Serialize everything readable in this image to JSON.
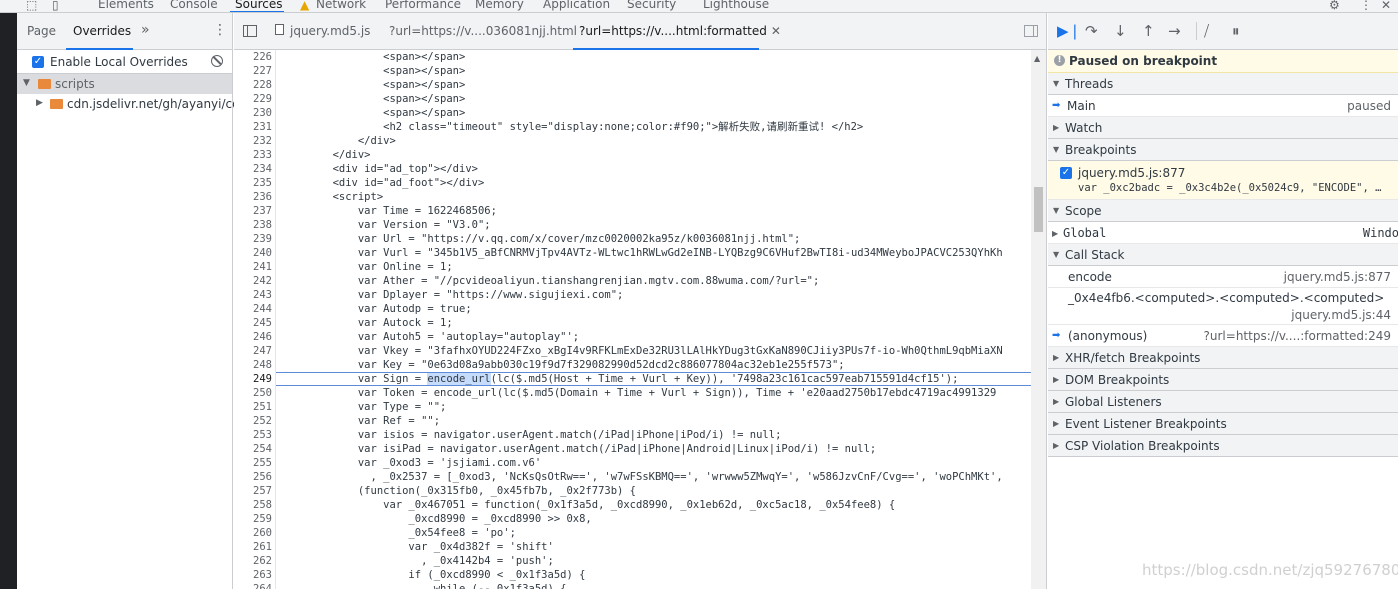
{
  "topbar": {
    "tabs": [
      "Elements",
      "Console",
      "Sources",
      "Network",
      "Performance",
      "Memory",
      "Application",
      "Security",
      "Lighthouse"
    ],
    "active_tab": "Sources",
    "close_glyph": "✕"
  },
  "navigator": {
    "tabs": [
      "Page",
      "Overrides"
    ],
    "active": "Overrides",
    "more": "»",
    "kebab": "⋮",
    "enable_local_overrides": "Enable Local Overrides",
    "tree": [
      {
        "label": "scripts"
      },
      {
        "label": "cdn.jsdelivr.net/gh/ayanyi/cdn@"
      }
    ]
  },
  "editor": {
    "tabs": [
      "jquery.md5.js",
      "?url=https://v....036081njj.html",
      "?url=https://v....html:formatted"
    ],
    "close_glyph": "✕",
    "lines": [
      {
        "n": "226",
        "t": "                <span></span>"
      },
      {
        "n": "227",
        "t": "                <span></span>"
      },
      {
        "n": "228",
        "t": "                <span></span>"
      },
      {
        "n": "229",
        "t": "                <span></span>"
      },
      {
        "n": "230",
        "t": "                <span></span>"
      },
      {
        "n": "231",
        "t": "                <h2 class=\"timeout\" style=\"display:none;color:#f90;\">解析失败,请刷新重试! </h2>"
      },
      {
        "n": "232",
        "t": "            </div>"
      },
      {
        "n": "233",
        "t": "        </div>"
      },
      {
        "n": "234",
        "t": "        <div id=\"ad_top\"></div>"
      },
      {
        "n": "235",
        "t": "        <div id=\"ad_foot\"></div>"
      },
      {
        "n": "236",
        "t": "        <script>"
      },
      {
        "n": "237",
        "t": "            var Time = 1622468506;"
      },
      {
        "n": "238",
        "t": "            var Version = \"V3.0\";"
      },
      {
        "n": "239",
        "t": "            var Url = \"https://v.qq.com/x/cover/mzc0020002ka95z/k0036081njj.html\";"
      },
      {
        "n": "240",
        "t": "            var Vurl = \"345b1V5_aBfCNRMVjTpv4AVTz-WLtwc1hRWLwGd2eINB-LYQBzg9C6VHuf2BwTI8i-ud34MWeyboJPACVC253QYhKh"
      },
      {
        "n": "241",
        "t": "            var Online = 1;"
      },
      {
        "n": "242",
        "t": "            var Ather = \"//pcvideoaliyun.tianshangrenjian.mgtv.com.88wuma.com/?url=\";"
      },
      {
        "n": "243",
        "t": "            var Dplayer = \"https://www.sigujiexi.com\";"
      },
      {
        "n": "244",
        "t": "            var Autodp = true;"
      },
      {
        "n": "245",
        "t": "            var Autock = 1;"
      },
      {
        "n": "246",
        "t": "            var Autoh5 = 'autoplay=\"autoplay\"';"
      },
      {
        "n": "247",
        "t": "            var Vkey = \"3fafhxOYUD224FZxo_xBgI4v9RFKLmExDe32RU3lLAlHkYDug3tGxKaN890CJiiy3PUs7f-io-Wh0QthmL9qbMiaXN"
      },
      {
        "n": "248",
        "t": "            var Key = \"0e63d08a9abb030c19f9d7f329082990d52dcd2c886077804ac32eb1e255f573\";"
      },
      {
        "n": "249",
        "t": "            var Sign = encode_url(lc($.md5(Host + Time + Vurl + Key)), '7498a23c161cac597eab715591d4cf15');"
      },
      {
        "n": "250",
        "t": "            var Token = encode_url(lc($.md5(Domain + Time + Vurl + Sign)), Time + 'e20aad2750b17ebdc4719ac4991329"
      },
      {
        "n": "251",
        "t": "            var Type = \"\";"
      },
      {
        "n": "252",
        "t": "            var Ref = \"\";"
      },
      {
        "n": "253",
        "t": "            var isios = navigator.userAgent.match(/iPad|iPhone|iPod/i) != null;"
      },
      {
        "n": "254",
        "t": "            var isiPad = navigator.userAgent.match(/iPad|iPhone|Android|Linux|iPod/i) != null;"
      },
      {
        "n": "255",
        "t": "            var _0xod3 = 'jsjiami.com.v6'"
      },
      {
        "n": "256",
        "t": "              , _0x2537 = [_0xod3, 'NcKsQsOtRw==', 'w7wFSsKBMQ==', 'wrwww5ZMwqY=', 'w586JzvCnF/Cvg==', 'woPChMKt',"
      },
      {
        "n": "257",
        "t": "            (function(_0x315fb0, _0x45fb7b, _0x2f773b) {"
      },
      {
        "n": "258",
        "t": "                var _0x467051 = function(_0x1f3a5d, _0xcd8990, _0x1eb62d, _0xc5ac18, _0x54fee8) {"
      },
      {
        "n": "259",
        "t": "                    _0xcd8990 = _0xcd8990 >> 0x8,"
      },
      {
        "n": "260",
        "t": "                    _0x54fee8 = 'po';"
      },
      {
        "n": "261",
        "t": "                    var _0x4d382f = 'shift'"
      },
      {
        "n": "262",
        "t": "                      , _0x4142b4 = 'push';"
      },
      {
        "n": "263",
        "t": "                    if (_0xcd8990 < _0x1f3a5d) {"
      },
      {
        "n": "264",
        "t": "                        while (--_0x1f3a5d) {"
      }
    ],
    "current_line": {
      "prefix": "            var Sign = ",
      "highlight": "encode_url",
      "suffix": "(lc($.md5(Host + Time + Vurl + Key)), '7498a23c161cac597eab715591d4cf15');"
    }
  },
  "debugger": {
    "paused_text": "Paused on breakpoint",
    "threads": {
      "title": "Threads",
      "main": "Main",
      "status": "paused"
    },
    "watch": "Watch",
    "breakpoints": {
      "title": "Breakpoints",
      "file": "jquery.md5.js:877",
      "code": "var _0xc2badc = _0x3c4b2e(_0x5024c9, \"ENCODE\", …"
    },
    "scope": {
      "title": "Scope",
      "global": "Global",
      "global_value": "Windo"
    },
    "call_stack": {
      "title": "Call Stack",
      "frames": [
        {
          "name": "encode",
          "loc": "jquery.md5.js:877"
        },
        {
          "name": "_0x4e4fb6.<computed>.<computed>.<computed>",
          "loc": "jquery.md5.js:44"
        },
        {
          "name": "(anonymous)",
          "loc": "?url=https://v....:formatted:249"
        }
      ]
    },
    "sections": [
      "XHR/fetch Breakpoints",
      "DOM Breakpoints",
      "Global Listeners",
      "Event Listener Breakpoints",
      "CSP Violation Breakpoints"
    ]
  },
  "watermark": "https://blog.csdn.net/zjq592767809",
  "colors": {
    "accent": "#1a73e8",
    "paused_bg": "#fffbe6",
    "warning": "#e8a600"
  }
}
